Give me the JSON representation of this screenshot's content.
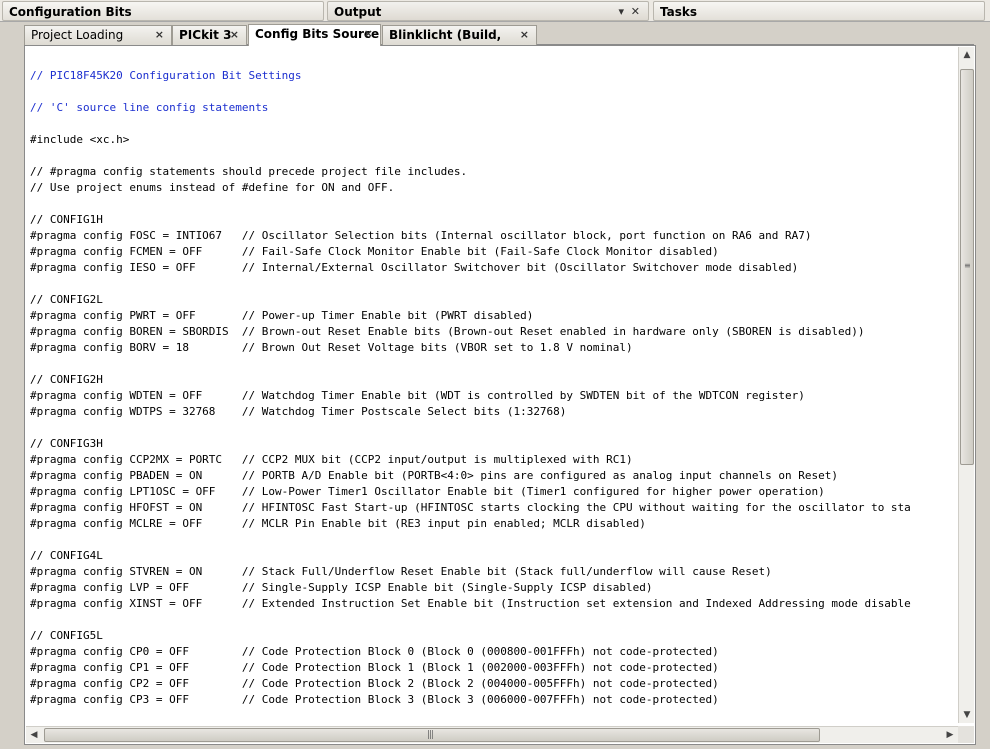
{
  "panels": {
    "config_bits": "Configuration Bits",
    "output": "Output",
    "tasks": "Tasks",
    "minimize_glyph": "▾",
    "close_glyph": "✕"
  },
  "tabs": [
    {
      "label": "Project Loading Warning",
      "close": "×"
    },
    {
      "label": "PICkit 3",
      "close": "×"
    },
    {
      "label": "Config Bits Source",
      "close": "×",
      "active": true
    },
    {
      "label": "Blinklicht (Build, Load)",
      "close": "×"
    }
  ],
  "colors": {
    "comment_blue": "#1c2fcf",
    "code_text": "#000000"
  },
  "code_lines": [
    "// PIC18F45K20 Configuration Bit Settings",
    "",
    "// 'C' source line config statements",
    "",
    "#include <xc.h>",
    "",
    "// #pragma config statements should precede project file includes.",
    "// Use project enums instead of #define for ON and OFF.",
    "",
    "// CONFIG1H",
    "#pragma config FOSC = INTIO67   // Oscillator Selection bits (Internal oscillator block, port function on RA6 and RA7)",
    "#pragma config FCMEN = OFF      // Fail-Safe Clock Monitor Enable bit (Fail-Safe Clock Monitor disabled)",
    "#pragma config IESO = OFF       // Internal/External Oscillator Switchover bit (Oscillator Switchover mode disabled)",
    "",
    "// CONFIG2L",
    "#pragma config PWRT = OFF       // Power-up Timer Enable bit (PWRT disabled)",
    "#pragma config BOREN = SBORDIS  // Brown-out Reset Enable bits (Brown-out Reset enabled in hardware only (SBOREN is disabled))",
    "#pragma config BORV = 18        // Brown Out Reset Voltage bits (VBOR set to 1.8 V nominal)",
    "",
    "// CONFIG2H",
    "#pragma config WDTEN = OFF      // Watchdog Timer Enable bit (WDT is controlled by SWDTEN bit of the WDTCON register)",
    "#pragma config WDTPS = 32768    // Watchdog Timer Postscale Select bits (1:32768)",
    "",
    "// CONFIG3H",
    "#pragma config CCP2MX = PORTC   // CCP2 MUX bit (CCP2 input/output is multiplexed with RC1)",
    "#pragma config PBADEN = ON      // PORTB A/D Enable bit (PORTB<4:0> pins are configured as analog input channels on Reset)",
    "#pragma config LPT1OSC = OFF    // Low-Power Timer1 Oscillator Enable bit (Timer1 configured for higher power operation)",
    "#pragma config HFOFST = ON      // HFINTOSC Fast Start-up (HFINTOSC starts clocking the CPU without waiting for the oscillator to sta",
    "#pragma config MCLRE = OFF      // MCLR Pin Enable bit (RE3 input pin enabled; MCLR disabled)",
    "",
    "// CONFIG4L",
    "#pragma config STVREN = ON      // Stack Full/Underflow Reset Enable bit (Stack full/underflow will cause Reset)",
    "#pragma config LVP = OFF        // Single-Supply ICSP Enable bit (Single-Supply ICSP disabled)",
    "#pragma config XINST = OFF      // Extended Instruction Set Enable bit (Instruction set extension and Indexed Addressing mode disable",
    "",
    "// CONFIG5L",
    "#pragma config CP0 = OFF        // Code Protection Block 0 (Block 0 (000800-001FFFh) not code-protected)",
    "#pragma config CP1 = OFF        // Code Protection Block 1 (Block 1 (002000-003FFFh) not code-protected)",
    "#pragma config CP2 = OFF        // Code Protection Block 2 (Block 2 (004000-005FFFh) not code-protected)",
    "#pragma config CP3 = OFF        // Code Protection Block 3 (Block 3 (006000-007FFFh) not code-protected)"
  ],
  "blue_lines": [
    0,
    2
  ],
  "scrollbar": {
    "up_glyph": "▲",
    "down_glyph": "▼",
    "left_glyph": "◀",
    "right_glyph": "▶",
    "grip_v": "≡",
    "grip_h": "|||"
  }
}
